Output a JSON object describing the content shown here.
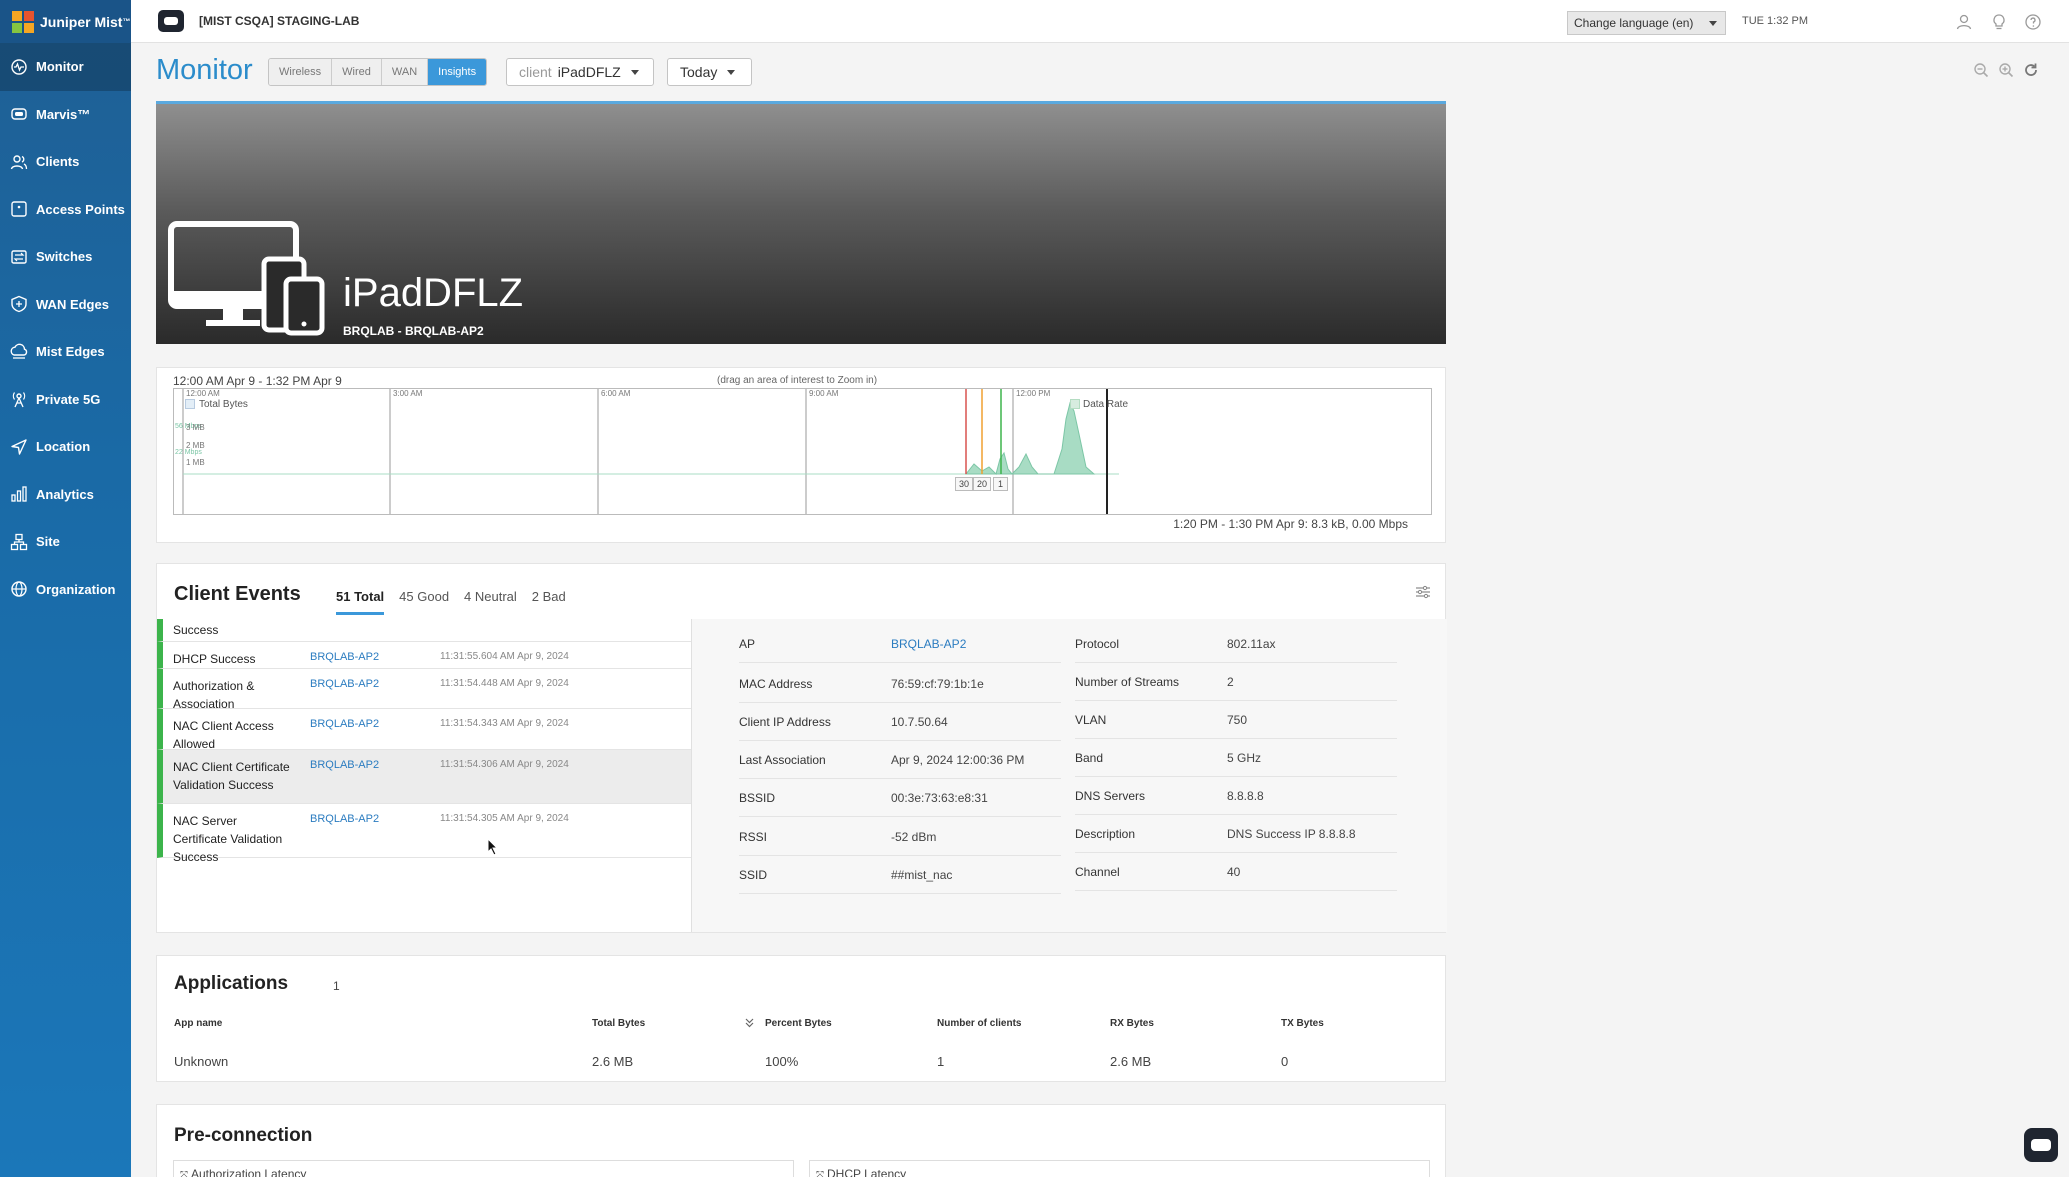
{
  "brand": {
    "name": "Juniper Mist",
    "tm": "™"
  },
  "sidebar": {
    "items": [
      {
        "label": "Monitor",
        "icon": "monitor-icon"
      },
      {
        "label": "Marvis™",
        "icon": "marvis-icon"
      },
      {
        "label": "Clients",
        "icon": "clients-icon"
      },
      {
        "label": "Access Points",
        "icon": "access-point-icon"
      },
      {
        "label": "Switches",
        "icon": "switch-icon"
      },
      {
        "label": "WAN Edges",
        "icon": "wan-edge-icon"
      },
      {
        "label": "Mist Edges",
        "icon": "mist-edge-icon"
      },
      {
        "label": "Private 5G",
        "icon": "antenna-icon"
      },
      {
        "label": "Location",
        "icon": "location-icon"
      },
      {
        "label": "Analytics",
        "icon": "analytics-icon"
      },
      {
        "label": "Site",
        "icon": "site-icon"
      },
      {
        "label": "Organization",
        "icon": "globe-icon"
      }
    ]
  },
  "topbar": {
    "org": "[MIST CSQA] STAGING-LAB",
    "language": "Change language (en)",
    "clock": "TUE 1:32 PM"
  },
  "header": {
    "title": "Monitor",
    "tabs": [
      "Wireless",
      "Wired",
      "WAN",
      "Insights"
    ],
    "active_tab": "Insights",
    "client_prefix": "client",
    "client_value": "iPadDFLZ",
    "period": "Today"
  },
  "banner": {
    "client_name": "iPadDFLZ",
    "location": "BRQLAB - BRQLAB-AP2"
  },
  "timeline": {
    "range": "12:00 AM Apr 9 - 1:32 PM Apr 9",
    "hint": "(drag an area of interest to Zoom in)",
    "ticks": [
      "12:00 AM",
      "3:00 AM",
      "6:00 AM",
      "9:00 AM",
      "12:00 PM"
    ],
    "legend_left": "Total Bytes",
    "legend_right": "Data Rate",
    "y_labels": [
      "3 MB",
      "2 MB",
      "1 MB"
    ],
    "y_overlap_labels": [
      "56 Mbps",
      "22 Mbps"
    ],
    "markers": [
      "30",
      "20",
      "1"
    ],
    "footer": "1:20 PM - 1:30 PM Apr 9: 8.3 kB, 0.00 Mbps",
    "colors": {
      "area": "#a8dcc4",
      "marker_red": "#d9534f",
      "marker_orange": "#f0a030",
      "marker_green": "#3cb44b",
      "cursor": "#222222"
    }
  },
  "client_events": {
    "title": "Client Events",
    "tabs": [
      "51 Total",
      "45 Good",
      "4 Neutral",
      "2 Bad"
    ],
    "active_tab": "51 Total",
    "rows": [
      {
        "name": "Success",
        "ap": "",
        "time": ""
      },
      {
        "name": "DHCP Success",
        "ap": "BRQLAB-AP2",
        "time": "11:31:55.604 AM Apr 9, 2024"
      },
      {
        "name": "Authorization & Association",
        "ap": "BRQLAB-AP2",
        "time": "11:31:54.448 AM Apr 9, 2024"
      },
      {
        "name": "NAC Client Access Allowed",
        "ap": "BRQLAB-AP2",
        "time": "11:31:54.343 AM Apr 9, 2024"
      },
      {
        "name": "NAC Client Certificate Validation Success",
        "ap": "BRQLAB-AP2",
        "time": "11:31:54.306 AM Apr 9, 2024"
      },
      {
        "name": "NAC Server Certificate Validation Success",
        "ap": "BRQLAB-AP2",
        "time": "11:31:54.305 AM Apr 9, 2024"
      }
    ],
    "details_left": [
      {
        "key": "AP",
        "value": "BRQLAB-AP2",
        "link": true
      },
      {
        "key": "MAC Address",
        "value": "76:59:cf:79:1b:1e"
      },
      {
        "key": "Client IP Address",
        "value": "10.7.50.64"
      },
      {
        "key": "Last Association",
        "value": "Apr 9, 2024 12:00:36 PM"
      },
      {
        "key": "BSSID",
        "value": "00:3e:73:63:e8:31"
      },
      {
        "key": "RSSI",
        "value": "-52 dBm"
      },
      {
        "key": "SSID",
        "value": "##mist_nac"
      }
    ],
    "details_right": [
      {
        "key": "Protocol",
        "value": "802.11ax"
      },
      {
        "key": "Number of Streams",
        "value": "2"
      },
      {
        "key": "VLAN",
        "value": "750"
      },
      {
        "key": "Band",
        "value": "5 GHz"
      },
      {
        "key": "DNS Servers",
        "value": "8.8.8.8"
      },
      {
        "key": "Description",
        "value": "DNS Success IP 8.8.8.8"
      },
      {
        "key": "Channel",
        "value": "40"
      }
    ]
  },
  "applications": {
    "title": "Applications",
    "count": "1",
    "columns": [
      "App name",
      "Total Bytes",
      "Percent Bytes",
      "Number of clients",
      "RX Bytes",
      "TX Bytes"
    ],
    "rows": [
      [
        "Unknown",
        "2.6 MB",
        "100%",
        "1",
        "2.6 MB",
        "0"
      ]
    ]
  },
  "preconnection": {
    "title": "Pre-connection",
    "boxes": [
      "Authorization Latency",
      "DHCP Latency"
    ]
  }
}
